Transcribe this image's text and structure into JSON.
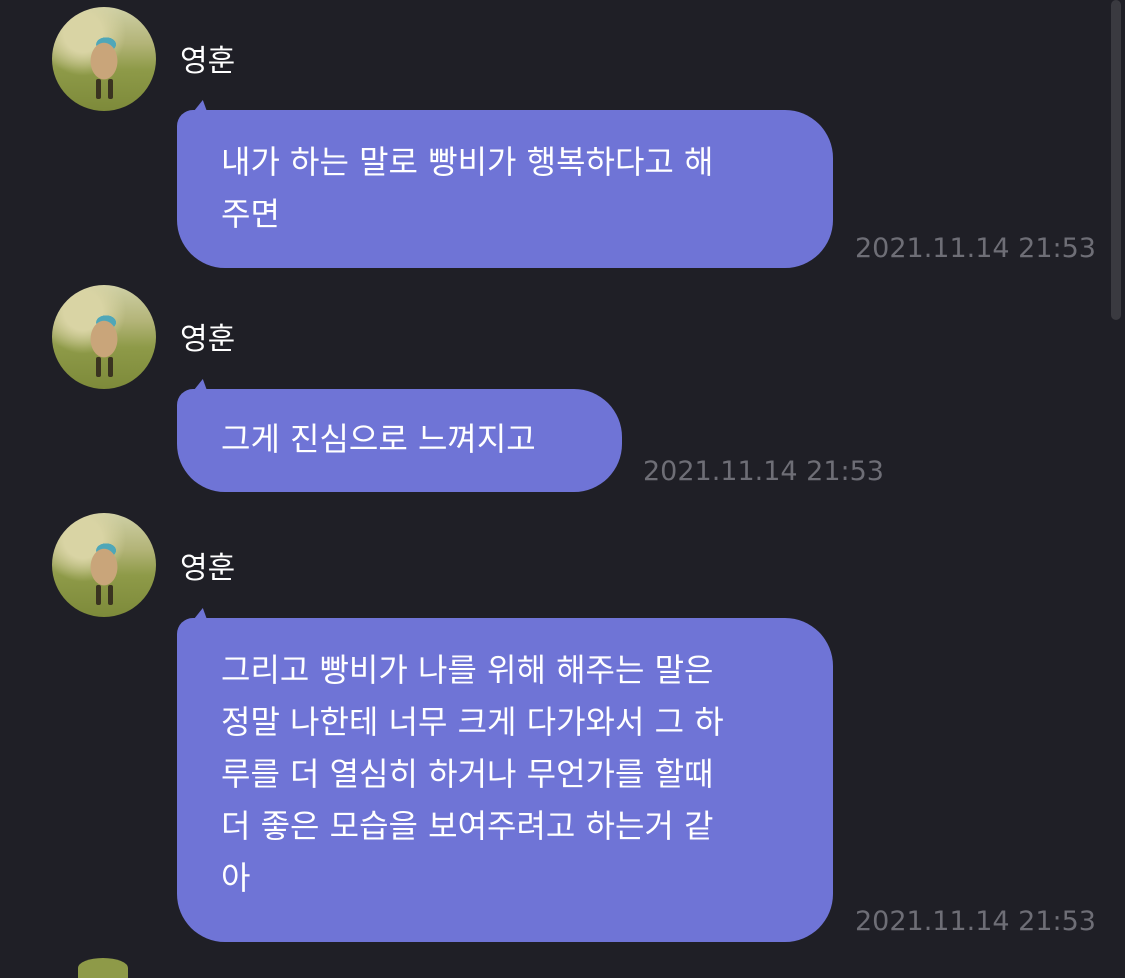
{
  "messages": [
    {
      "sender": "영훈",
      "text": "내가 하는 말로 빵비가 행복하다고 해\n주면",
      "time": "2021.11.14 21:53"
    },
    {
      "sender": "영훈",
      "text": "그게 진심으로 느껴지고",
      "time": "2021.11.14 21:53"
    },
    {
      "sender": "영훈",
      "text": "그리고 빵비가 나를 위해 해주는 말은\n정말 나한테 너무 크게 다가와서 그 하\n루를 더 열심히 하거나 무언가를 할때\n더 좋은 모습을 보여주려고 하는거 같\n아",
      "time": "2021.11.14 21:53"
    }
  ],
  "colors": {
    "background": "#1f1f26",
    "bubble": "#6f74d6",
    "timestamp": "#6e6e76"
  },
  "icons": {
    "avatar": "dog-photo-avatar"
  }
}
